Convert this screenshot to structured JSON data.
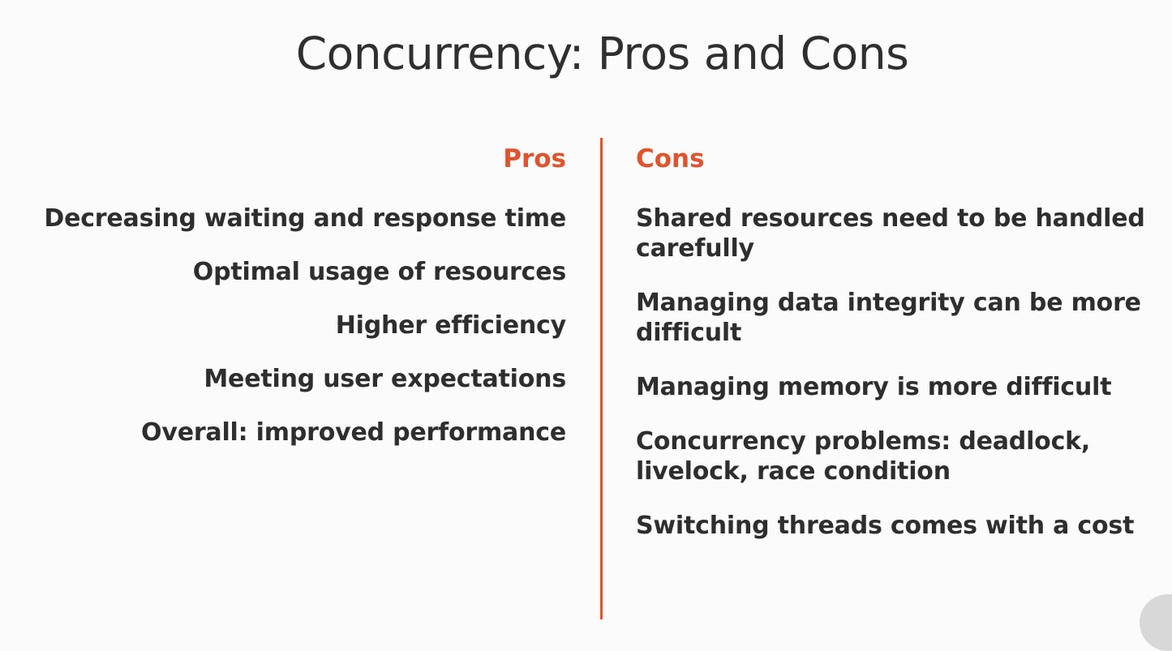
{
  "slide": {
    "title": "Concurrency: Pros and Cons",
    "accent_color": "#e0532d",
    "text_color": "#2e2e2e"
  },
  "pros": {
    "heading": "Pros",
    "items": [
      "Decreasing waiting and response time",
      "Optimal usage of resources",
      "Higher efficiency",
      "Meeting user expectations",
      "Overall: improved performance"
    ]
  },
  "cons": {
    "heading": "Cons",
    "items": [
      "Shared resources need to be handled carefully",
      "Managing data integrity can be more difficult",
      "Managing memory is more difficult",
      "Concurrency problems: deadlock, livelock, race condition",
      "Switching threads comes with a cost"
    ]
  }
}
